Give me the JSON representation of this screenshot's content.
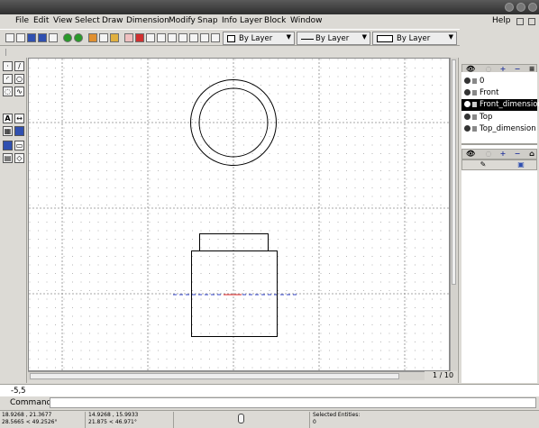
{
  "window": {
    "buttons": [
      "minimize",
      "maximize",
      "close"
    ]
  },
  "menubar": {
    "items": [
      "File",
      "Edit",
      "View",
      "Select",
      "Draw",
      "Dimension",
      "Modify",
      "Snap",
      "Info",
      "Layer",
      "Block",
      "Window"
    ],
    "help": "Help"
  },
  "toolbar": {
    "color_combo": "By Layer",
    "linetype_combo": "By Layer",
    "linewidth_combo": "By Layer"
  },
  "drawing": {
    "page_info": "1 / 10"
  },
  "layers": {
    "items": [
      "0",
      "Front",
      "Front_dimension",
      "Top",
      "Top_dimension"
    ],
    "selected": "Front_dimension"
  },
  "command": {
    "history": "-5,5",
    "label": "Command:",
    "value": ""
  },
  "status": {
    "abs_coord": "18.9268 , 21.3677",
    "abs_polar": "28.5665 < 49.2526°",
    "rel_coord": "14.9268 , 15.9933",
    "rel_polar": "21.875 < 46.971°",
    "selected_label": "Selected Entities:",
    "selected_count": "0"
  },
  "colors": {
    "background": "#dcdad5",
    "canvas": "#ffffff",
    "grid": "#9e9e9e",
    "selected_layer": "#000000",
    "axis_blue": "#3344cc",
    "axis_red": "#dd2222"
  }
}
